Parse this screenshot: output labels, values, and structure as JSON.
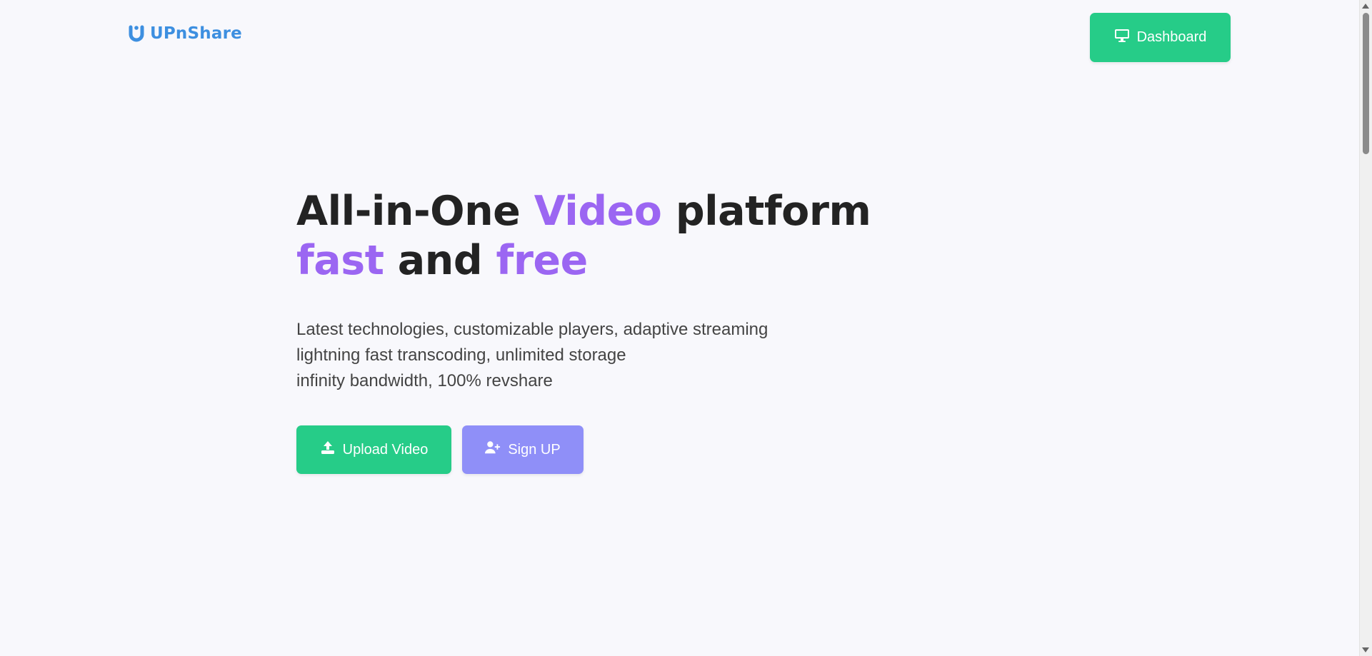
{
  "header": {
    "logo_text": "UPnShare",
    "dashboard_label": "Dashboard"
  },
  "hero": {
    "headline_1": "All-in-One",
    "headline_2": "Video",
    "headline_3": "platform",
    "headline_4": "fast",
    "headline_5": "and",
    "headline_6": "free",
    "sub_line_1": "Latest technologies, customizable players, adaptive streaming",
    "sub_line_2": "lightning fast transcoding, unlimited storage",
    "sub_line_3": "infinity bandwidth, 100% revshare"
  },
  "cta": {
    "upload_label": "Upload Video",
    "signup_label": "Sign UP"
  },
  "icons": {
    "logo": "upnshare-logo-icon",
    "dashboard": "desktop-icon",
    "upload": "upload-icon",
    "signup": "user-plus-icon"
  },
  "colors": {
    "brand_blue": "#3d8fe0",
    "accent_green": "#26cc88",
    "accent_purple_text": "#9b66f2",
    "signup_button": "#8f8ff8",
    "background": "#f8f8fc"
  }
}
